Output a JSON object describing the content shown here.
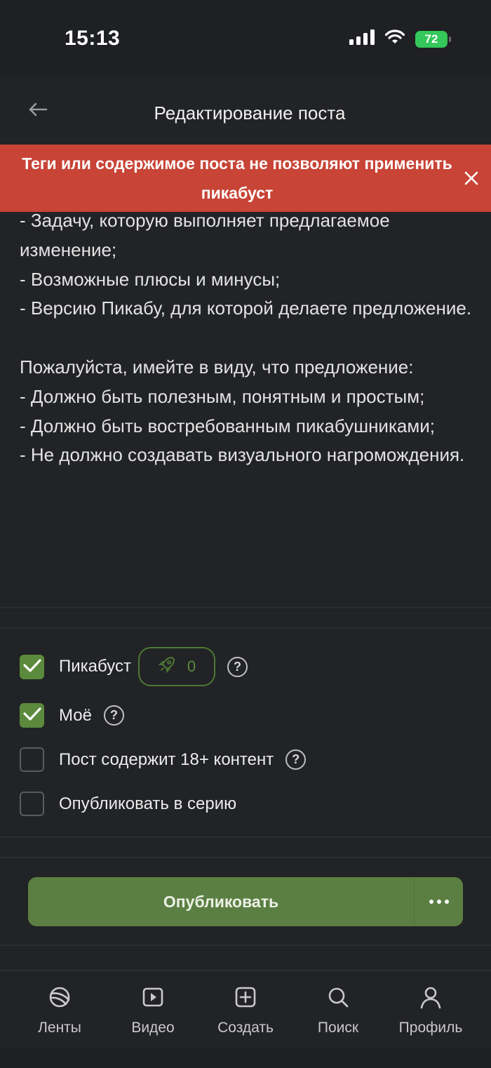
{
  "status_bar": {
    "time": "15:13",
    "battery": "72",
    "icons": [
      "signal-icon",
      "wifi-icon",
      "battery-icon"
    ]
  },
  "header": {
    "title": "Редактирование поста",
    "back_icon": "arrow-left-icon"
  },
  "toast": {
    "message": "Теги или содержимое поста не позволяют применить пикабуст",
    "color": "#c84436",
    "close_icon": "close-icon"
  },
  "post_body": {
    "text": "- Задачу, которую выполняет предлагаемое изменение;\n- Возможные плюсы и минусы;\n- Версию Пикабу, для которой делаете предложение.\n\nПожалуйста, имейте в виду, что предложение:\n- Должно быть полезным, понятным и простым;\n- Должно быть востребованным пикабушниками;\n- Не должно создавать визуального нагромождения."
  },
  "options": {
    "pikaboost": {
      "label": "Пикабуст",
      "checked": true,
      "boost_count": "0",
      "boost_icon": "rocket-icon"
    },
    "mine": {
      "label": "Моё",
      "checked": true
    },
    "nsfw": {
      "label": "Пост содержит 18+ контент",
      "checked": false
    },
    "series": {
      "label": "Опубликовать в серию",
      "checked": false
    }
  },
  "actions": {
    "publish_label": "Опубликовать",
    "more_icon": "more-dots-icon",
    "accent_color": "#5b7f42"
  },
  "tabbar": {
    "items": [
      {
        "label": "Ленты",
        "icon": "planet-icon"
      },
      {
        "label": "Видео",
        "icon": "video-icon"
      },
      {
        "label": "Создать",
        "icon": "plus-square-icon"
      },
      {
        "label": "Поиск",
        "icon": "search-icon"
      },
      {
        "label": "Профиль",
        "icon": "profile-icon"
      }
    ]
  }
}
